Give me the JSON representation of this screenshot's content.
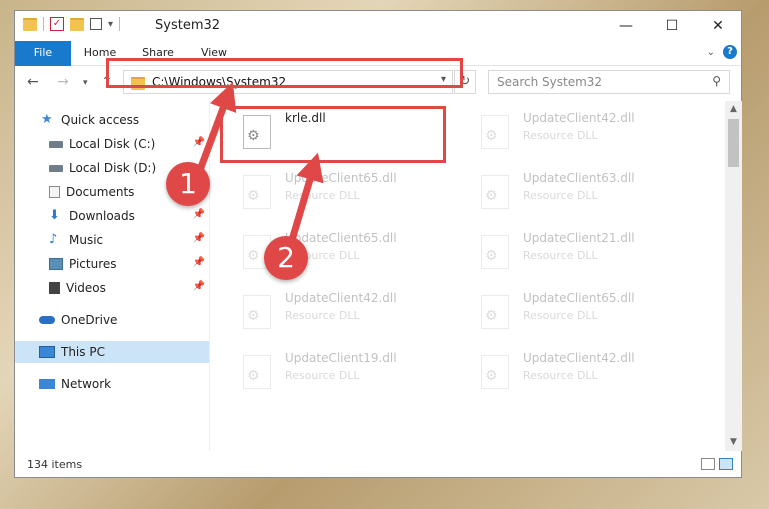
{
  "window": {
    "title": "System32"
  },
  "window_controls": {
    "minimize": "—",
    "maximize": "☐",
    "close": "✕"
  },
  "ribbon": {
    "tabs": [
      "File",
      "Home",
      "Share",
      "View"
    ]
  },
  "nav": {
    "address": "C:\\Windows\\System32",
    "search_placeholder": "Search System32"
  },
  "sidebar": {
    "items": [
      {
        "label": "Quick access",
        "icon": "star-icon",
        "color": "#3a87d6"
      },
      {
        "label": "Local Disk (C:)",
        "icon": "drive-icon",
        "color": "#6f7c8a"
      },
      {
        "label": "Local Disk (D:)",
        "icon": "drive-icon",
        "color": "#6f7c8a"
      },
      {
        "label": "Documents",
        "icon": "documents-icon",
        "color": "#8a8a8a"
      },
      {
        "label": "Downloads",
        "icon": "download-icon",
        "color": "#2b79d0"
      },
      {
        "label": "Music",
        "icon": "music-icon",
        "color": "#2b79d0"
      },
      {
        "label": "Pictures",
        "icon": "pictures-icon",
        "color": "#5a8fb8"
      },
      {
        "label": "Videos",
        "icon": "videos-icon",
        "color": "#444"
      },
      {
        "label": "OneDrive",
        "icon": "cloud-icon",
        "color": "#2b6fc4"
      },
      {
        "label": "This PC",
        "icon": "computer-icon",
        "color": "#3a87d6"
      },
      {
        "label": "Network",
        "icon": "network-icon",
        "color": "#3a87d6"
      }
    ]
  },
  "files": {
    "selected": {
      "name": "krle.dll"
    },
    "items": [
      {
        "name": "UpdateClient42.dll",
        "type": "Resource DLL"
      },
      {
        "name": "UpdateClient65.dll",
        "type": "Resource DLL"
      },
      {
        "name": "UpdateClient63.dll",
        "type": "Resource DLL"
      },
      {
        "name": "UpdateClient65.dll",
        "type": "Resource DLL"
      },
      {
        "name": "UpdateClient21.dll",
        "type": "Resource DLL"
      },
      {
        "name": "UpdateClient42.dll",
        "type": "Resource DLL"
      },
      {
        "name": "UpdateClient65.dll",
        "type": "Resource DLL"
      },
      {
        "name": "UpdateClient19.dll",
        "type": "Resource DLL"
      },
      {
        "name": "UpdateClient42.dll",
        "type": "Resource DLL"
      }
    ]
  },
  "status": {
    "item_count": "134 items"
  },
  "annotations": {
    "step1": "1",
    "step2": "2",
    "highlight_color": "#e04848"
  }
}
